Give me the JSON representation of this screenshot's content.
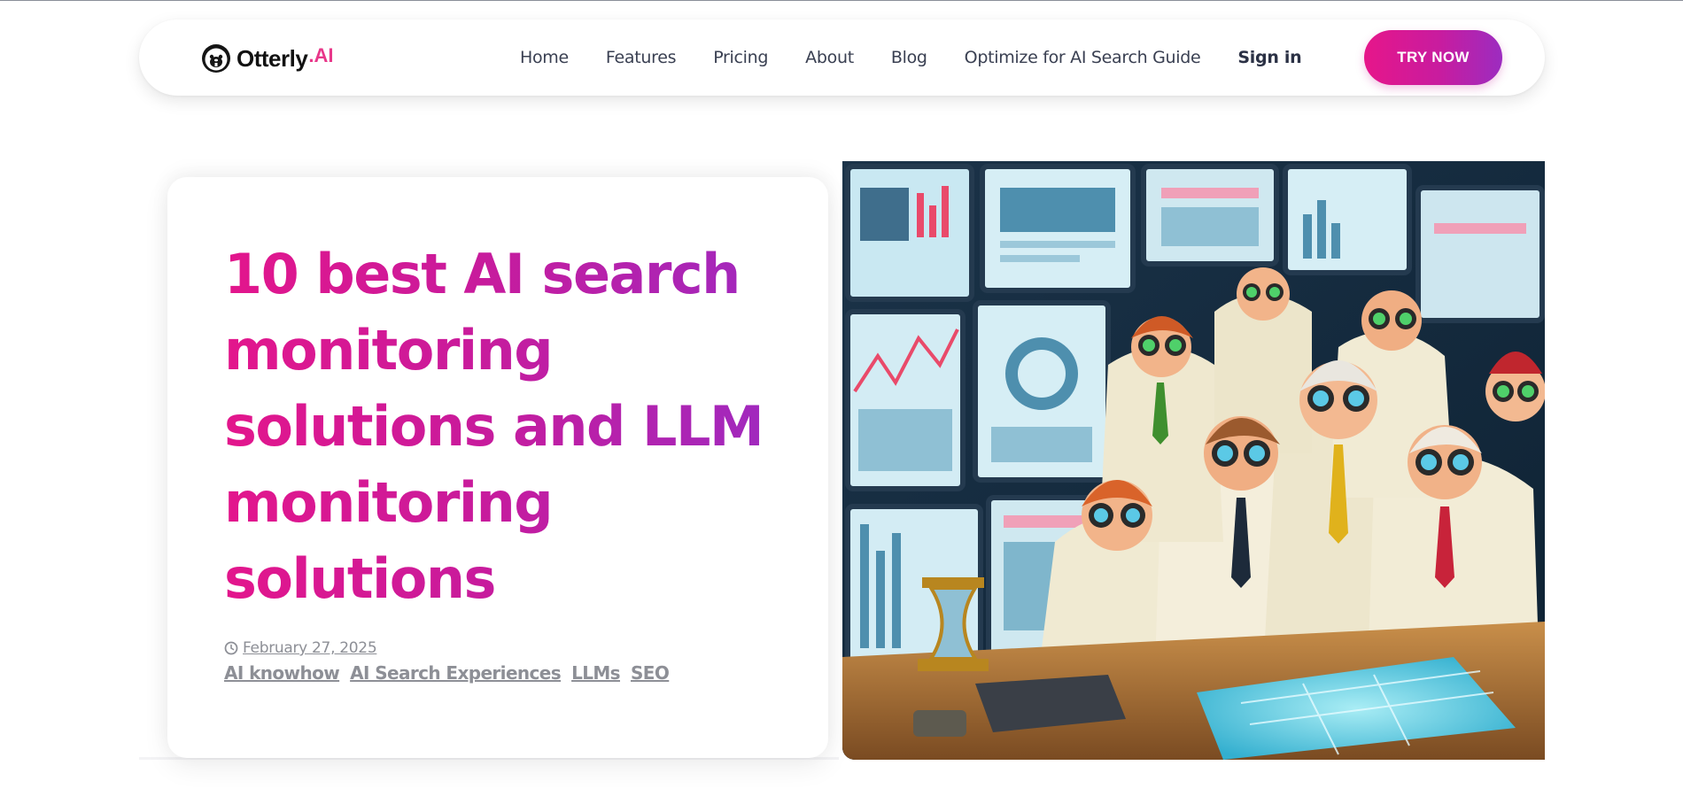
{
  "brand": {
    "name": "Otterly",
    "dot": ".",
    "suffix": "AI"
  },
  "nav": {
    "items": [
      {
        "label": "Home"
      },
      {
        "label": "Features"
      },
      {
        "label": "Pricing"
      },
      {
        "label": "About"
      },
      {
        "label": "Blog"
      },
      {
        "label": "Optimize for AI Search Guide"
      }
    ],
    "signin_label": "Sign in",
    "cta_label": "TRY NOW"
  },
  "hero": {
    "title": "10 best AI search monitoring solutions and LLM monitoring solutions",
    "date": "February 27, 2025",
    "tags": [
      "AI knowhow",
      "AI Search Experiences",
      "LLMs",
      "SEO"
    ]
  },
  "colors": {
    "accent_start": "#e3168c",
    "accent_end": "#9d2ac1",
    "meta_gray": "#8d8f96",
    "nav_text": "#3a4052"
  },
  "icons": {
    "logo": "otter-logo-icon",
    "date": "clock-icon"
  }
}
